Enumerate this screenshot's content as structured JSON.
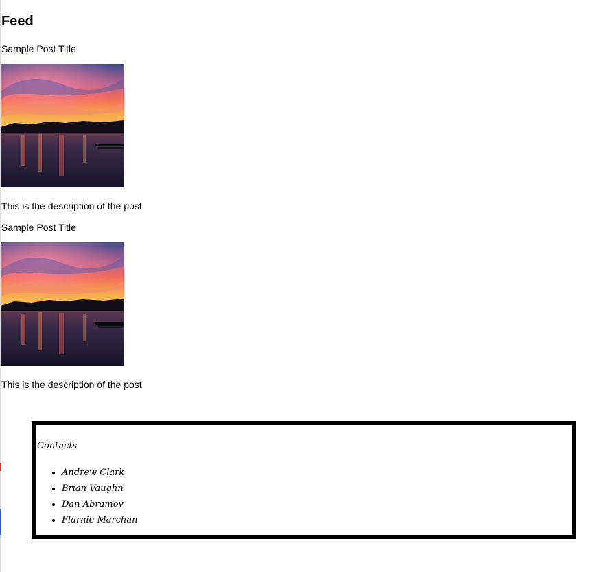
{
  "feed": {
    "title": "Feed",
    "posts": [
      {
        "title": "Sample Post Title",
        "description": "This is the description of the post"
      },
      {
        "title": "Sample Post Title",
        "description": "This is the description of the post"
      }
    ]
  },
  "contacts": {
    "title": "Contacts",
    "items": [
      "Andrew Clark",
      "Brian Vaughn",
      "Dan Abramov",
      "Flarnie Marchan"
    ]
  },
  "colors": {
    "border": "#000000",
    "background": "#ffffff",
    "text": "#000000"
  }
}
